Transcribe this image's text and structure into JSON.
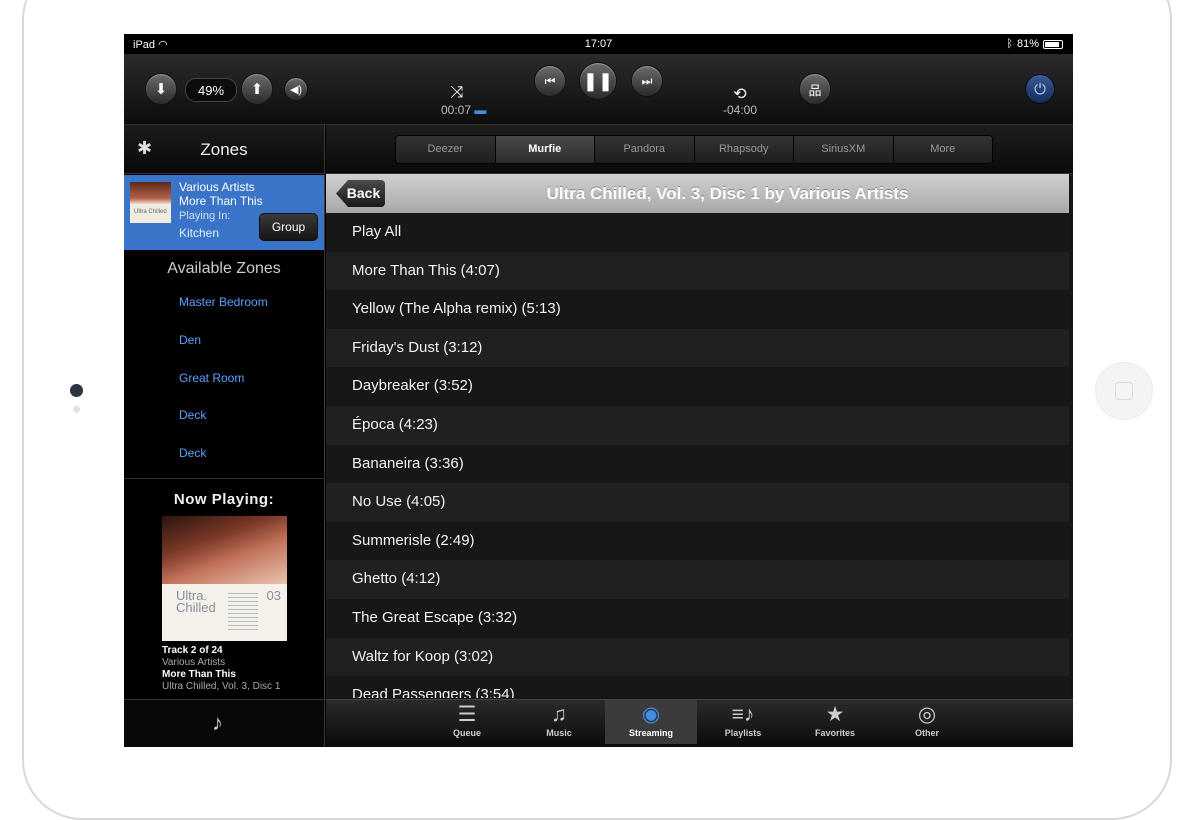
{
  "status": {
    "device": "iPad",
    "time": "17:07",
    "battery": "81%"
  },
  "transport": {
    "volume": "49%",
    "elapsed": "00:07",
    "remaining": "-04:00"
  },
  "sidebar": {
    "zones_title": "Zones",
    "current": {
      "artist": "Various Artists",
      "track": "More Than This",
      "playing_in_label": "Playing In:",
      "zone": "Kitchen",
      "group_label": "Group",
      "art_text": "Ultra Chilled"
    },
    "available_title": "Available Zones",
    "zones": [
      "Master Bedroom",
      "Den",
      "Great Room",
      "Deck",
      "Deck"
    ],
    "now_playing": {
      "title": "Now Playing:",
      "art_title": "Ultra.\nChilled",
      "art_number": "03",
      "track_pos": "Track 2 of 24",
      "artist": "Various Artists",
      "track": "More Than This",
      "album": "Ultra Chilled, Vol. 3, Disc 1"
    }
  },
  "services": [
    "Deezer",
    "Murfie",
    "Pandora",
    "Rhapsody",
    "SiriusXM",
    "More"
  ],
  "active_service": "Murfie",
  "header": {
    "back": "Back",
    "title": "Ultra Chilled, Vol. 3, Disc 1 by Various Artists"
  },
  "tracks": [
    "Play All",
    "More Than This (4:07)",
    "Yellow (The Alpha remix) (5:13)",
    "Friday's Dust (3:12)",
    "Daybreaker (3:52)",
    "Época (4:23)",
    "Bananeira (3:36)",
    "No Use (4:05)",
    "Summerisle (2:49)",
    "Ghetto (4:12)",
    "The Great Escape (3:32)",
    "Waltz for Koop (3:02)",
    "Dead Passengers (3:54)"
  ],
  "tabs": [
    {
      "label": "Queue",
      "icon": "list-icon"
    },
    {
      "label": "Music",
      "icon": "music-note-icon"
    },
    {
      "label": "Streaming",
      "icon": "streaming-icon"
    },
    {
      "label": "Playlists",
      "icon": "playlists-icon"
    },
    {
      "label": "Favorites",
      "icon": "star-icon"
    },
    {
      "label": "Other",
      "icon": "disc-icon"
    }
  ],
  "active_tab": "Streaming",
  "colors": {
    "accent": "#3a74c8",
    "link": "#5aa0ff",
    "tab_active_icon": "#3d8fe8"
  }
}
